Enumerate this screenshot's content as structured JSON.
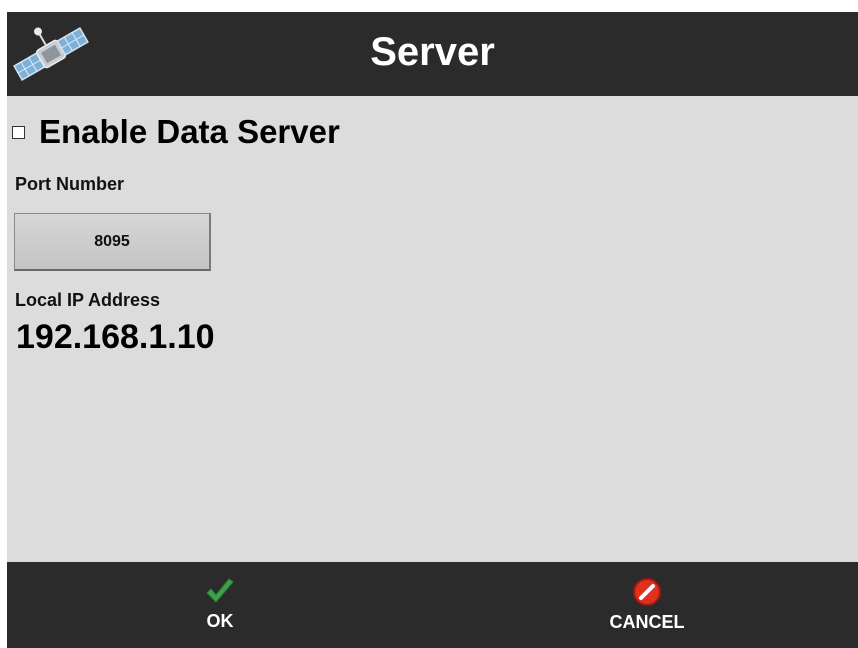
{
  "header": {
    "title": "Server",
    "icon": "satellite-icon"
  },
  "settings": {
    "enable_label": "Enable Data Server",
    "enable_checked": false,
    "port_label": "Port Number",
    "port_value": "8095",
    "ip_label": "Local IP Address",
    "ip_value": "192.168.1.10"
  },
  "footer": {
    "ok_label": "OK",
    "cancel_label": "CANCEL",
    "ok_icon": "checkmark-icon",
    "cancel_icon": "cancel-icon"
  },
  "colors": {
    "bar_background": "#2b2b2b",
    "panel_background": "#dcdcdc",
    "ok_green": "#3aa44a",
    "cancel_red": "#e0301e"
  }
}
